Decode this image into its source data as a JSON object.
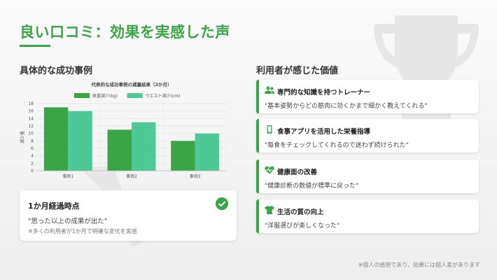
{
  "page": {
    "title": "良い口コミ：効果を実感した声",
    "footnote": "※個人の感想であり、効果には個人差があります"
  },
  "left": {
    "section_title": "具体的な成功事例",
    "milestone": {
      "title": "1か月経過時点",
      "quote": "\"思った以上の成果が出た\"",
      "note": "※多くの利用者が1か月で明確な変化を実感"
    }
  },
  "right": {
    "section_title": "利用者が感じた価値",
    "cards": [
      {
        "icon": "users-icon",
        "title": "専門的な知識を持つトレーナー",
        "quote": "\"基本姿勢からどの筋肉に効くかまで細かく教えてくれる\""
      },
      {
        "icon": "smartphone-icon",
        "title": "食事アプリを活用した栄養指導",
        "quote": "\"毎食をチェックしてくれるので迷わず続けられた\""
      },
      {
        "icon": "heartbeat-icon",
        "title": "健康面の改善",
        "quote": "\"健康診断の数値が標準に戻った\""
      },
      {
        "icon": "tshirt-icon",
        "title": "生活の質の向上",
        "quote": "\"洋服選びが楽しくなった\""
      }
    ]
  },
  "colors": {
    "accent": "#3aa546",
    "series1": "#3aa546",
    "series2": "#4dc896"
  },
  "chart_data": {
    "type": "bar",
    "title": "代表的な成功事例の減量結果（2か月）",
    "ylabel": "減少量",
    "xlabel": "",
    "categories": [
      "事例1",
      "事例2",
      "事例3"
    ],
    "series": [
      {
        "name": "体重減少(kg)",
        "values": [
          17,
          11,
          8
        ]
      },
      {
        "name": "ウエスト減少(cm)",
        "values": [
          16,
          13,
          10
        ]
      }
    ],
    "ylim": [
      0,
      18
    ],
    "yticks": [
      0,
      2,
      4,
      6,
      8,
      10,
      12,
      14,
      16,
      18
    ],
    "grid": true,
    "legend": "top"
  }
}
